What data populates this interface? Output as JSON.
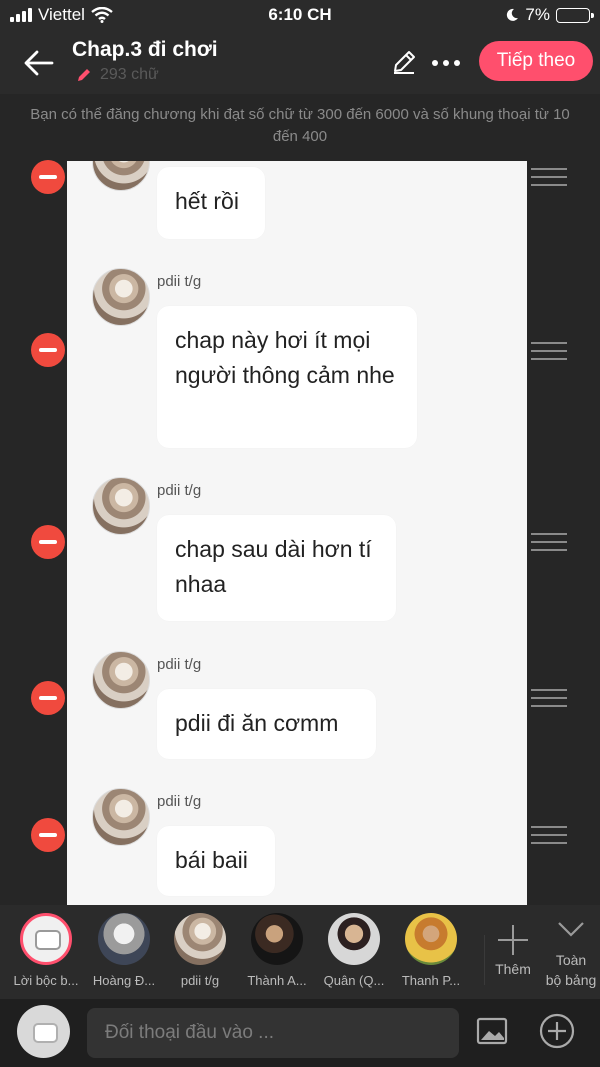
{
  "status_bar": {
    "carrier": "Viettel",
    "time": "6:10 CH",
    "battery": "7%"
  },
  "header": {
    "title": "Chap.3 đi chơi",
    "word_count": "293 chữ",
    "next_label": "Tiếp theo"
  },
  "notice": "Bạn có thể đăng chương khi đạt số chữ từ 300 đến 6000 và số khung thoại từ 10 đến 400",
  "messages": [
    {
      "author": "",
      "text": "hết rồi"
    },
    {
      "author": "pdii t/g",
      "text": "chap này hơi ít mọi người thông cảm nhe"
    },
    {
      "author": "pdii t/g",
      "text": "chap sau dài hơn tí nhaa"
    },
    {
      "author": "pdii t/g",
      "text": "pdii đi ăn cơmm"
    },
    {
      "author": "pdii t/g",
      "text": "bái baii"
    }
  ],
  "characters": [
    {
      "name": "Lời bộc b...",
      "icon": "narration-icon"
    },
    {
      "name": "Hoàng Đ..."
    },
    {
      "name": "pdii t/g"
    },
    {
      "name": "Thành A..."
    },
    {
      "name": "Quân (Q..."
    },
    {
      "name": "Thanh P..."
    }
  ],
  "add_label": "Thêm",
  "board_label_1": "Toàn",
  "board_label_2": "bộ bảng",
  "input": {
    "placeholder": "Đối thoại đầu vào ..."
  },
  "colors": {
    "accent": "#ff4f6d",
    "delete": "#f04a3e",
    "background": "#262626"
  }
}
